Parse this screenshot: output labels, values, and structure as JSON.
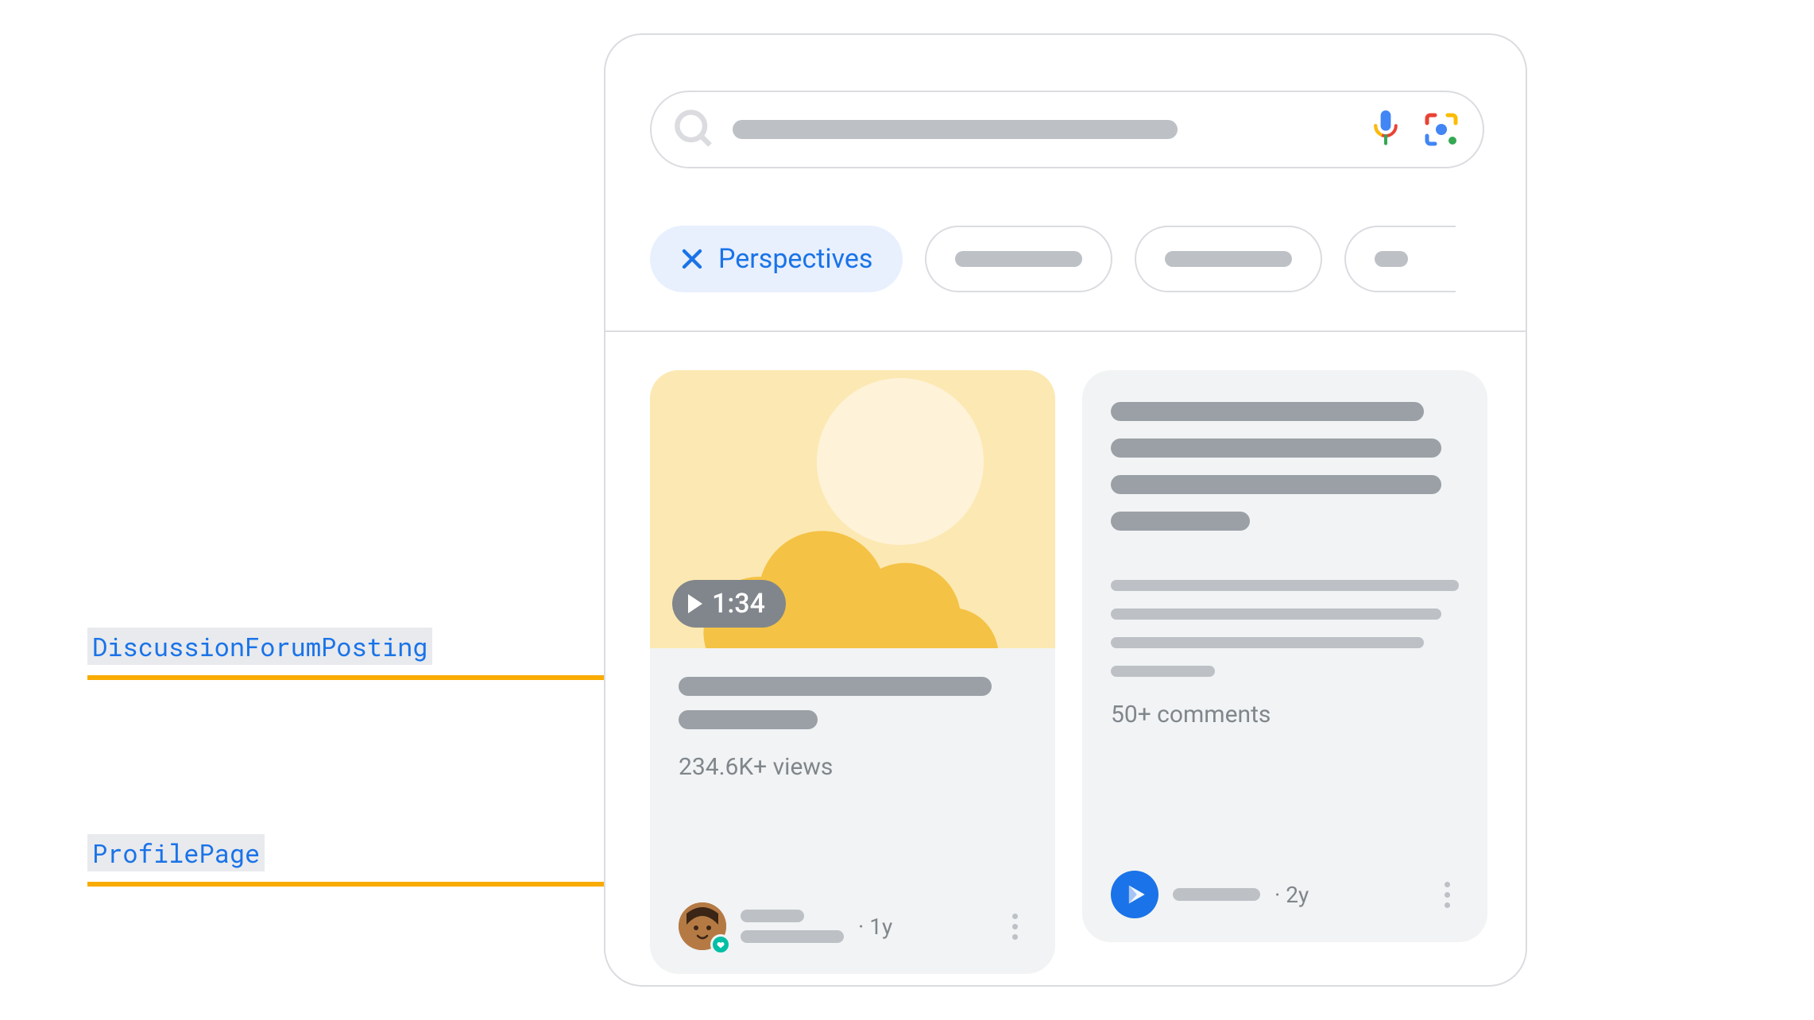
{
  "annotations": {
    "discussion": "DiscussionForumPosting",
    "profile": "ProfilePage"
  },
  "search": {
    "placeholder": ""
  },
  "chips": {
    "selected_label": "Perspectives"
  },
  "card1": {
    "duration": "1:34",
    "views": "234.6K+ views",
    "age": "1y"
  },
  "card2": {
    "comments": "50+ comments",
    "age": "2y"
  },
  "colors": {
    "annotation_line": "#f9ab00",
    "link_blue": "#1a73e8"
  }
}
